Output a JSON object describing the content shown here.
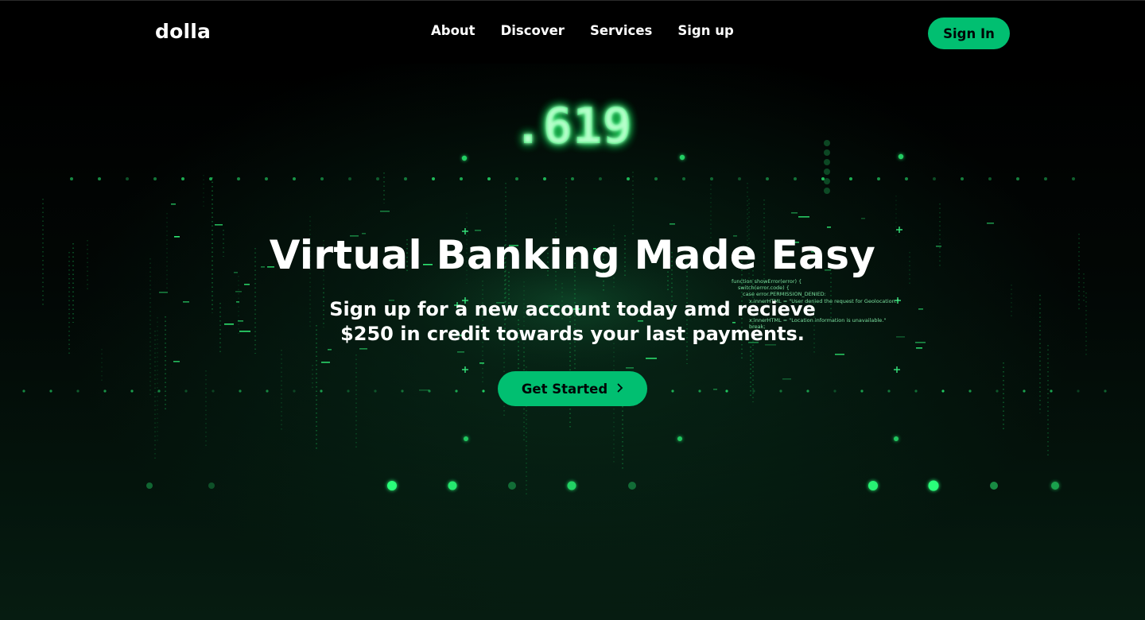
{
  "nav": {
    "logo": "dolla",
    "links": [
      "About",
      "Discover",
      "Services",
      "Sign up"
    ],
    "signin_label": "Sign In"
  },
  "hero": {
    "title": "Virtual Banking Made Easy",
    "subtitle_lines": [
      "Sign up for a new account today amd recieve",
      "$250 in credit towards your last payments."
    ],
    "cta_label": "Get Started",
    "cta_icon": "chevron-right-icon",
    "bg_counter": ".619",
    "bg_code_lines": [
      "function showError(error) {",
      "switch(error.code) {",
      "case error.PERMISSION_DENIED:",
      "x.innerHTML = \"User denied the request for Geolocation.\"",
      "x.innerHTML = \"Location information is unavailable.\"",
      "break;"
    ]
  },
  "colors": {
    "accent": "#01bf71",
    "nav_bg": "#000000",
    "text": "#ffffff",
    "button_text": "#010606",
    "matrix_green": "#2bff7a"
  }
}
